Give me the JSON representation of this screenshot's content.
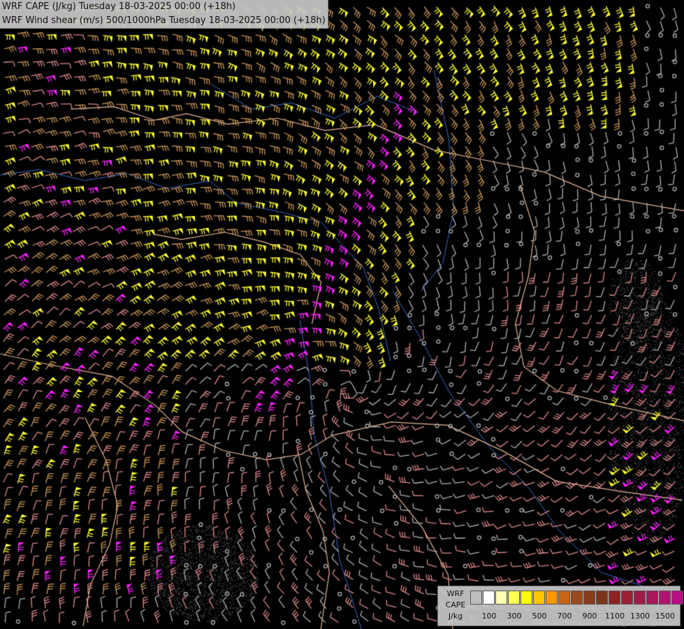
{
  "titles": {
    "line1": "WRF CAPE (J/kg) Tuesday 18-03-2025 00:00 (+18h)",
    "line2": "WRF Wind shear (m/s) 500/1000hPa Tuesday 18-03-2025 00:00 (+18h)"
  },
  "legend": {
    "label_lines": [
      "WRF",
      "CAPE",
      "J/kg"
    ],
    "ticks": [
      "100",
      "300",
      "500",
      "700",
      "900",
      "1100",
      "1300",
      "1500"
    ],
    "colors": [
      "#bdbdbd",
      "#ffffff",
      "#ffffb0",
      "#ffff55",
      "#ffff00",
      "#ffc400",
      "#ff9600",
      "#c86414",
      "#9c4a1c",
      "#8a3c1c",
      "#7a341c",
      "#8c2424",
      "#9a2034",
      "#a01c48",
      "#a8185c",
      "#b01470",
      "#b81084"
    ]
  },
  "map": {
    "background": "#000000",
    "border_color": "#e8b89a",
    "river_color": "#3c6ec8",
    "barb_colors": {
      "weak": "#b4b4b4",
      "moderate": "#e08c8c",
      "brown": "#c8965a",
      "strong": "#ffff33",
      "magenta": "#ff22ff"
    }
  }
}
